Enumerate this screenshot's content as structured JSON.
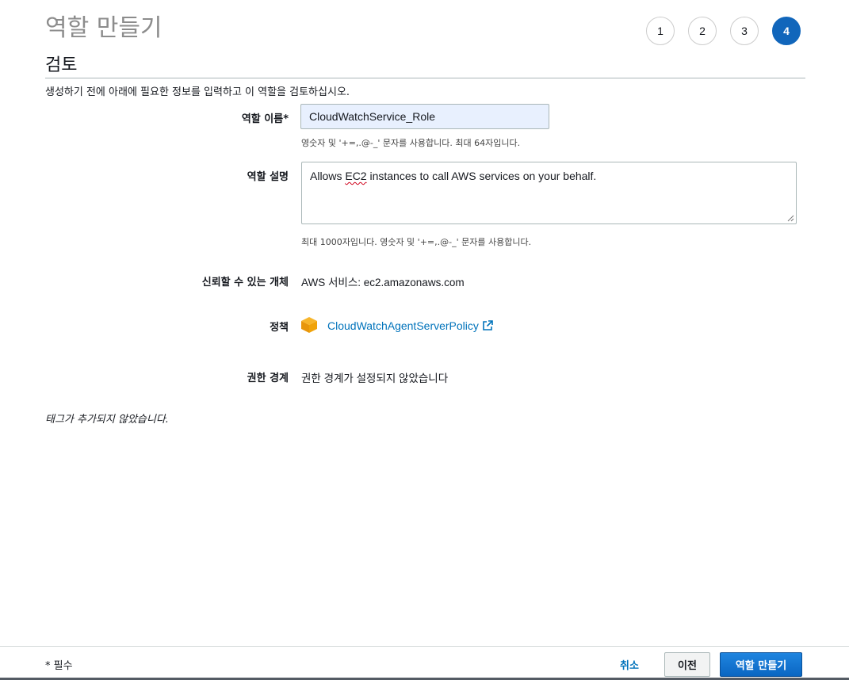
{
  "page": {
    "title": "역할 만들기",
    "section_title": "검토",
    "intro": "생성하기 전에 아래에 필요한 정보를 입력하고 이 역할을 검토하십시오."
  },
  "steps": [
    "1",
    "2",
    "3",
    "4"
  ],
  "active_step": "4",
  "form": {
    "role_name_label": "역할 이름*",
    "role_name_value": "CloudWatchService_Role",
    "role_name_hint": "영숫자 및 '+=,.@-_' 문자를 사용합니다. 최대 64자입니다.",
    "description_label": "역할 설명",
    "description_before": "Allows ",
    "description_flagged": "EC2",
    "description_after": " instances to call AWS services on your behalf.",
    "description_hint": "최대 1000자입니다. 영숫자 및 '+=,.@-_' 문자를 사용합니다.",
    "trusted_entity_label": "신뢰할 수 있는 개체",
    "trusted_entity_value": "AWS 서비스: ec2.amazonaws.com",
    "policies_label": "정책",
    "policy_link": "CloudWatchAgentServerPolicy",
    "boundary_label": "권한 경계",
    "boundary_value": "권한 경계가 설정되지 않았습니다"
  },
  "tags_note": "태그가 추가되지 않았습니다.",
  "footer": {
    "required_note": "* 필수",
    "cancel": "취소",
    "previous": "이전",
    "create": "역할 만들기"
  },
  "colors": {
    "accent": "#1166bb",
    "link": "#0073bb",
    "policy_icon": "#f0a30a"
  },
  "icons": {
    "policy": "policy-cube-icon",
    "external": "external-link-icon"
  }
}
